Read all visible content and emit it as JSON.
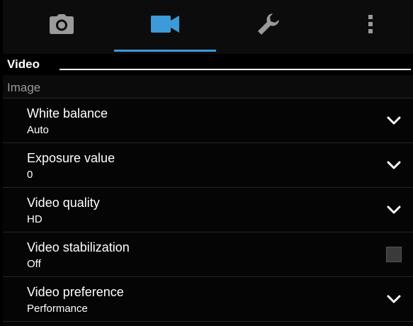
{
  "colors": {
    "accent": "#3d9ad8",
    "background": "#050505",
    "icon_inactive": "#9a9a9a",
    "text_secondary": "#9a9a9a"
  },
  "tabs": [
    {
      "icon": "camera-icon",
      "active": false
    },
    {
      "icon": "video-camera-icon",
      "active": true
    },
    {
      "icon": "wrench-icon",
      "active": false
    },
    {
      "icon": "more-vertical-icon",
      "active": false
    }
  ],
  "section": {
    "title": "Video"
  },
  "subsection": {
    "label": "Image"
  },
  "settings": [
    {
      "title": "White balance",
      "value": "Auto",
      "control": "chevron-down-icon"
    },
    {
      "title": "Exposure value",
      "value": "0",
      "control": "chevron-down-icon"
    },
    {
      "title": "Video quality",
      "value": "HD",
      "control": "chevron-down-icon"
    },
    {
      "title": "Video stabilization",
      "value": "Off",
      "control": "checkbox",
      "checked": false
    },
    {
      "title": "Video preference",
      "value": "Performance",
      "control": "chevron-down-icon"
    }
  ]
}
